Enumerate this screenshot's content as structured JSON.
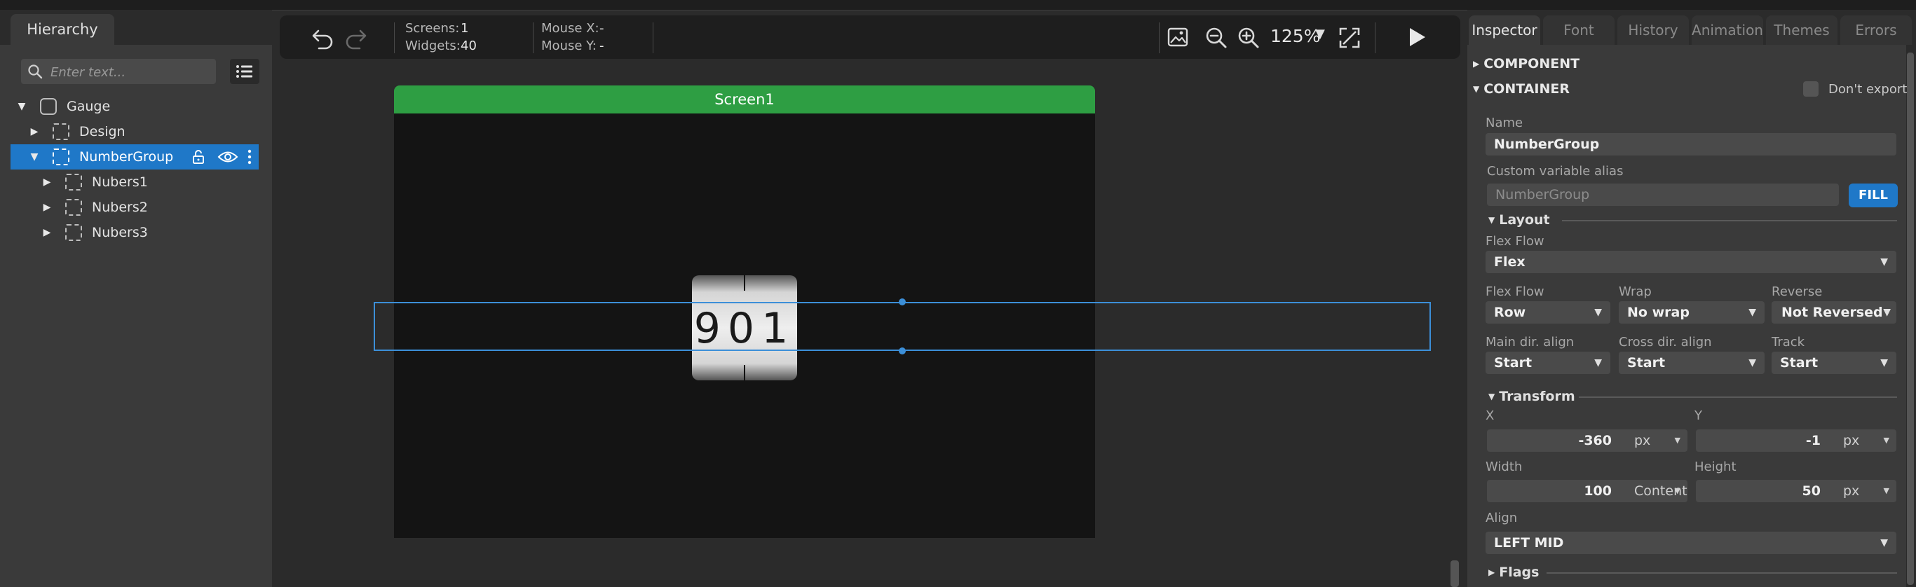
{
  "hierarchy": {
    "tab_label": "Hierarchy",
    "search_placeholder": "Enter text...",
    "tree": [
      {
        "label": "Gauge",
        "level": 0,
        "expanded": true
      },
      {
        "label": "Design",
        "level": 1,
        "expanded": false
      },
      {
        "label": "NumberGroup",
        "level": 1,
        "expanded": true,
        "selected": true
      },
      {
        "label": "Nubers1",
        "level": 2,
        "expanded": false
      },
      {
        "label": "Nubers2",
        "level": 2,
        "expanded": false
      },
      {
        "label": "Nubers3",
        "level": 2,
        "expanded": false
      }
    ]
  },
  "toolbar": {
    "screens_label": "Screens:",
    "screens_value": "1",
    "widgets_label": "Widgets:",
    "widgets_value": "40",
    "mouse_x_label": "Mouse X:",
    "mouse_x_value": "-",
    "mouse_y_label": "Mouse Y:",
    "mouse_y_value": "-",
    "zoom": "125%"
  },
  "canvas": {
    "screen_name": "Screen1",
    "gauge_digits": "901"
  },
  "inspector": {
    "tabs": [
      "Inspector",
      "Font",
      "History",
      "Animation",
      "Themes",
      "Errors"
    ],
    "component_header": "COMPONENT",
    "container_header": "CONTAINER",
    "dont_export_label": "Don't export",
    "name_label": "Name",
    "name_value": "NumberGroup",
    "alias_label": "Custom variable alias",
    "alias_placeholder": "NumberGroup",
    "fill_button": "FILL",
    "layout_header": "Layout",
    "flex_flow_label": "Flex Flow",
    "flex_flow_value": "Flex",
    "flex_flow2_label": "Flex Flow",
    "flex_flow2_value": "Row",
    "wrap_label": "Wrap",
    "wrap_value": "No wrap",
    "reverse_label": "Reverse",
    "reverse_value": "Not Reversed",
    "main_align_label": "Main dir. align",
    "main_align_value": "Start",
    "cross_align_label": "Cross dir. align",
    "cross_align_value": "Start",
    "track_label": "Track",
    "track_value": "Start",
    "transform_header": "Transform",
    "x_label": "X",
    "x_value": "-360",
    "x_unit": "px",
    "y_label": "Y",
    "y_value": "-1",
    "y_unit": "px",
    "width_label": "Width",
    "width_value": "100",
    "width_unit": "Content",
    "height_label": "Height",
    "height_value": "50",
    "height_unit": "px",
    "align_label": "Align",
    "align_value": "LEFT MID",
    "flags_header": "Flags"
  },
  "colors": {
    "accent": "#1f78c8",
    "screen_header": "#2e9e43",
    "selection": "#3c8fd8"
  }
}
